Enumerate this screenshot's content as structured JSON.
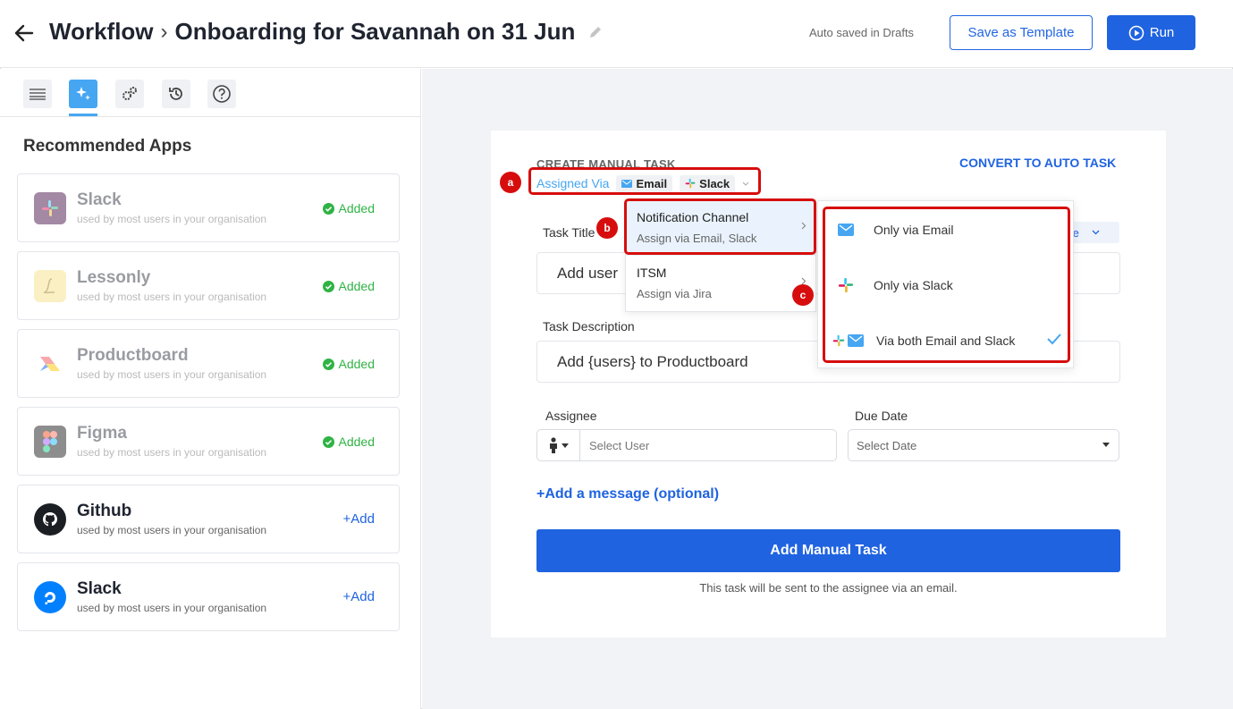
{
  "header": {
    "root": "Workflow",
    "separator": "›",
    "title": "Onboarding for Savannah on 31 Jun",
    "autosave": "Auto saved in Drafts",
    "save_template": "Save as Template",
    "run": "Run"
  },
  "sidebar": {
    "title": "Recommended Apps",
    "apps": [
      {
        "name": "Slack",
        "sub": "used by most users in your organisation",
        "status": "Added"
      },
      {
        "name": "Lessonly",
        "sub": "used by most users in your organisation",
        "status": "Added"
      },
      {
        "name": "Productboard",
        "sub": "used by most users in your organisation",
        "status": "Added"
      },
      {
        "name": "Figma",
        "sub": "used by most users in your organisation",
        "status": "Added"
      },
      {
        "name": "Github",
        "sub": "used by most users in your organisation",
        "status": "+Add"
      },
      {
        "name": "Slack",
        "sub": "used by most users in your organisation",
        "status": "+Add"
      }
    ]
  },
  "task": {
    "heading": "CREATE MANUAL TASK",
    "convert": "CONVERT TO AUTO TASK",
    "assigned_via_label": "Assigned Via",
    "chip_email": "Email",
    "chip_slack": "Slack",
    "title_label": "Task Title",
    "title_value": "Add user",
    "type_fragment": "te",
    "desc_label": "Task Description",
    "desc_value": "Add {users} to Productboard",
    "assignee_label": "Assignee",
    "assignee_placeholder": "Select User",
    "due_label": "Due Date",
    "due_placeholder": "Select Date",
    "add_message": "+Add a message (optional)",
    "add_button": "Add Manual Task",
    "note": "This task will be sent to the assignee via an email."
  },
  "menu": {
    "items": [
      {
        "title": "Notification Channel",
        "sub": "Assign via Email, Slack"
      },
      {
        "title": "ITSM",
        "sub": "Assign via Jira"
      }
    ]
  },
  "submenu": {
    "items": [
      {
        "label": "Only via Email"
      },
      {
        "label": "Only via Slack"
      },
      {
        "label": "Via both Email and Slack",
        "selected": true
      }
    ]
  },
  "markers": {
    "a": "a",
    "b": "b",
    "c": "c"
  },
  "colors": {
    "primary": "#1f63e0",
    "accent": "#46a6f2",
    "success": "#2fb344",
    "highlight": "#d70d0d"
  }
}
